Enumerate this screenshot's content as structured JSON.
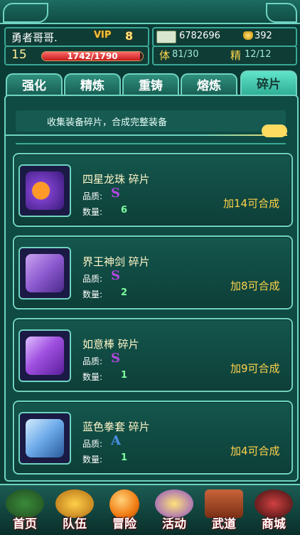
{
  "player": {
    "name": "勇者哥哥.",
    "vip_label": "VIP",
    "vip_level": "8",
    "level": "15",
    "exp_text": "1742/1790",
    "exp_fraction": 0.973,
    "money": "6782696",
    "gold": "392",
    "stamina_label": "体",
    "stamina": "81/30",
    "spirit_label": "精",
    "spirit": "12/12"
  },
  "tabs": [
    "强化",
    "精炼",
    "重铸",
    "熔炼",
    "碎片"
  ],
  "active_tab": "碎片",
  "hint": "收集装备碎片，合成完整装备",
  "items": [
    {
      "name": "四星龙珠 碎片",
      "quality_label": "品质:",
      "quality": "S",
      "qty_label": "数量:",
      "qty": "6",
      "merge": "加14可合成",
      "color": "#8a5ad6"
    },
    {
      "name": "界王神剑 碎片",
      "quality_label": "品质:",
      "quality": "S",
      "qty_label": "数量:",
      "qty": "2",
      "merge": "加8可合成",
      "color": "#b07ae0"
    },
    {
      "name": "如意棒 碎片",
      "quality_label": "品质:",
      "quality": "S",
      "qty_label": "数量:",
      "qty": "1",
      "merge": "加9可合成",
      "color": "#9b5ad6"
    },
    {
      "name": "蓝色拳套 碎片",
      "quality_label": "品质:",
      "quality": "A",
      "qty_label": "数量:",
      "qty": "1",
      "merge": "加4可合成",
      "color": "#3a78c9"
    }
  ],
  "nav": [
    {
      "label": "首页",
      "icon": "dragon-icon"
    },
    {
      "label": "队伍",
      "icon": "warriors-icon"
    },
    {
      "label": "冒险",
      "icon": "dragonball-icon"
    },
    {
      "label": "活动",
      "icon": "treasure-icon"
    },
    {
      "label": "武道",
      "icon": "dojo-icon"
    },
    {
      "label": "商城",
      "icon": "merchant-icon"
    }
  ],
  "colors": {
    "quality_s": "#9b3ad0",
    "quality_a": "#4a90e2",
    "merge_text": "#ffd24a",
    "accent": "#6fd3c1"
  }
}
